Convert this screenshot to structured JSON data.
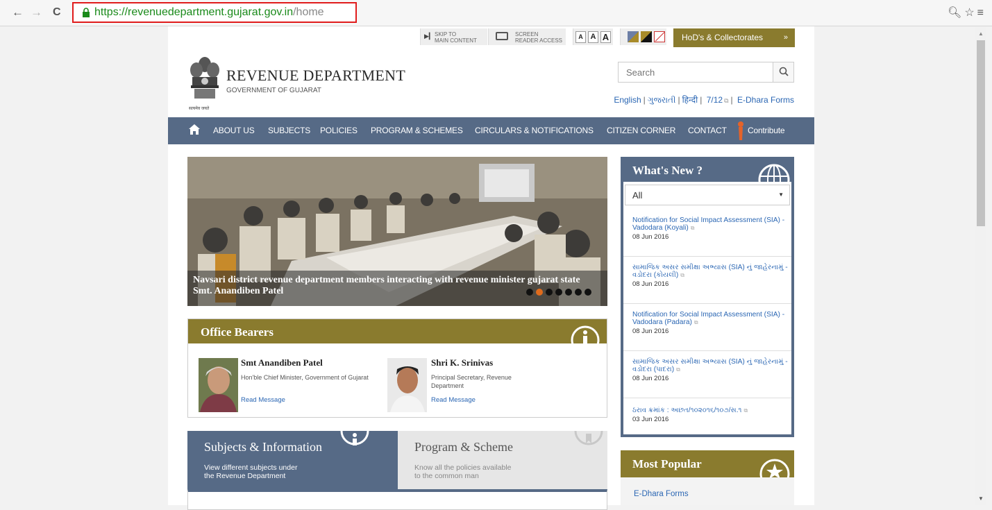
{
  "browser": {
    "url_host": "https://revenuedepartment.gujarat.gov.in",
    "url_path": "/home",
    "back_label": "←",
    "forward_label": "→",
    "reload_label": "C",
    "zoom_icon": "zoom-out-icon",
    "star_icon": "bookmark-star-icon",
    "menu_icon": "hamburger-menu-icon"
  },
  "utility": {
    "skip_line1": "Skip to",
    "skip_line2": "main content",
    "reader_line1": "Screen",
    "reader_line2": "reader access",
    "font_small": "A",
    "font_medium": "A",
    "font_large": "A",
    "hod_label": "HoD's & Collectorates",
    "hod_chevron": "»"
  },
  "header": {
    "title": "REVENUE DEPARTMENT",
    "subtitle": "GOVERNMENT OF GUJARAT",
    "emblem_motto": "सत्यमेव जयते",
    "search_placeholder": "Search",
    "lang_links": [
      "English",
      "ગુજરાતી",
      "हिन्दी",
      "7/12",
      "E-Dhara Forms"
    ]
  },
  "nav": {
    "items": [
      "ABOUT US",
      "SUBJECTS",
      "POLICIES",
      "PROGRAM & SCHEMES",
      "CIRCULARS & NOTIFICATIONS",
      "CITIZEN CORNER",
      "CONTACT",
      "Contribute"
    ]
  },
  "slider": {
    "caption": "Navsari district revenue department members interacting with revenue minister gujarat state Smt. Anandiben Patel",
    "slide_count": 7,
    "active_slide": 2
  },
  "office_bearers": {
    "title": "Office Bearers",
    "people": [
      {
        "name": "Smt Anandiben Patel",
        "role": "Hon'ble Chief Minister, Government of Gujarat",
        "link": "Read Message"
      },
      {
        "name": "Shri K. Srinivas",
        "role": "Principal Secretary, Revenue Department",
        "link": "Read Message"
      }
    ]
  },
  "tabs": {
    "subjects_title": "Subjects & Information",
    "subjects_desc_1": "View different subjects under",
    "subjects_desc_2": "the Revenue Department",
    "program_title": "Program & Scheme",
    "program_desc_1": "Know all the policies available",
    "program_desc_2": "to the common man"
  },
  "whats_new": {
    "title": "What's New ?",
    "filter_value": "All",
    "items": [
      {
        "text": "Notification for Social Impact Assessment (SIA) - Vadodara (Koyali)",
        "date": "08 Jun 2016"
      },
      {
        "text": "સામાજિક અસર સમીક્ષા અભ્યાસ (SIA) નું જાહેરનામું - વડોદરા (કોયલી)",
        "date": "08 Jun 2016"
      },
      {
        "text": "Notification for Social Impact Assessment (SIA) - Vadodara (Padara)",
        "date": "08 Jun 2016"
      },
      {
        "text": "સામાજિક અસર સમીક્ષા અભ્યાસ (SIA) નું જાહેરનામું - વડોદરા (પાદરા)",
        "date": "08 Jun 2016"
      },
      {
        "text": "ઠરાવ ક્રમાંક : અછત/૧૦૨૦૧૬/૧૦૭/સ.૧",
        "date": "03 Jun 2016"
      }
    ]
  },
  "most_popular": {
    "title": "Most Popular",
    "items": [
      "E-Dhara Forms"
    ]
  },
  "colors": {
    "nav_blue": "#566a86",
    "olive": "#8a7b2e",
    "link_blue": "#2a66b3",
    "url_green": "#1a8a1a",
    "highlight_red": "#e01b1b",
    "active_dot": "#e06b1c"
  }
}
